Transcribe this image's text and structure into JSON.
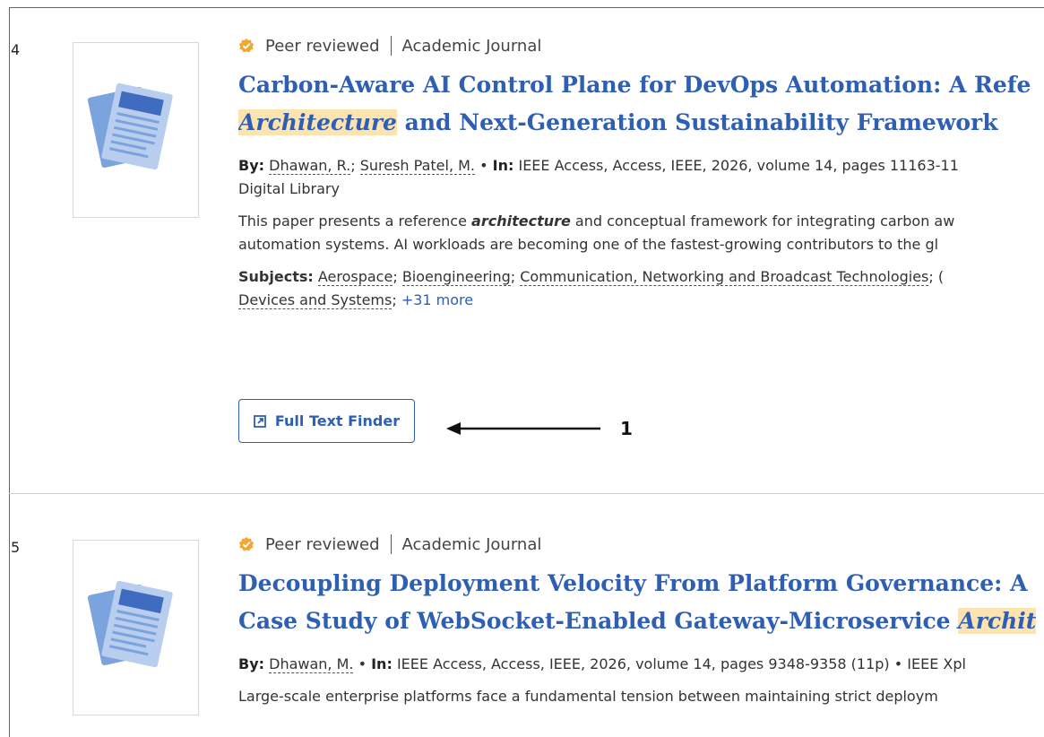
{
  "results": [
    {
      "number": "4",
      "peer_reviewed": "Peer reviewed",
      "type": "Academic Journal",
      "title_line1": "Carbon-Aware AI Control Plane for DevOps Automation: A Refe",
      "title_hl": "Architecture",
      "title_line2_rest": " and Next-Generation Sustainability Framework",
      "by_label": "By:",
      "authors": [
        "Dhawan, R.",
        "Suresh Patel, M."
      ],
      "in_label": "In:",
      "source": "IEEE Access, Access, IEEE, 2026, volume 14, pages 11163-11",
      "source_line2": "Digital Library",
      "abstract_pre": "This paper presents a reference ",
      "abstract_hl": "architecture",
      "abstract_post": " and conceptual framework for integrating carbon aw",
      "abstract_line2": "automation systems. AI workloads are becoming one of the fastest-growing contributors to the gl",
      "subjects_label": "Subjects:",
      "subjects": [
        "Aerospace",
        "Bioengineering",
        "Communication, Networking and Broadcast Technologies",
        "Devices and Systems"
      ],
      "subjects_more": "+31 more",
      "full_text_label": "Full Text Finder"
    },
    {
      "number": "5",
      "peer_reviewed": "Peer reviewed",
      "type": "Academic Journal",
      "title_line1": "Decoupling Deployment Velocity From Platform Governance: A",
      "title_line2_pre": "Case Study of WebSocket-Enabled Gateway-Microservice ",
      "title_hl": "Archit",
      "by_label": "By:",
      "authors": [
        "Dhawan, M."
      ],
      "in_label": "In:",
      "source": "IEEE Access, Access, IEEE, 2026, volume 14, pages 9348-9358 (11p) • IEEE Xpl",
      "abstract_line1": "Large-scale enterprise platforms face a fundamental tension between maintaining strict deploym"
    }
  ],
  "annotation": {
    "label": "1"
  },
  "colors": {
    "link": "#2e5fb2",
    "highlight": "#fde3b0",
    "badge": "#f0a830"
  }
}
